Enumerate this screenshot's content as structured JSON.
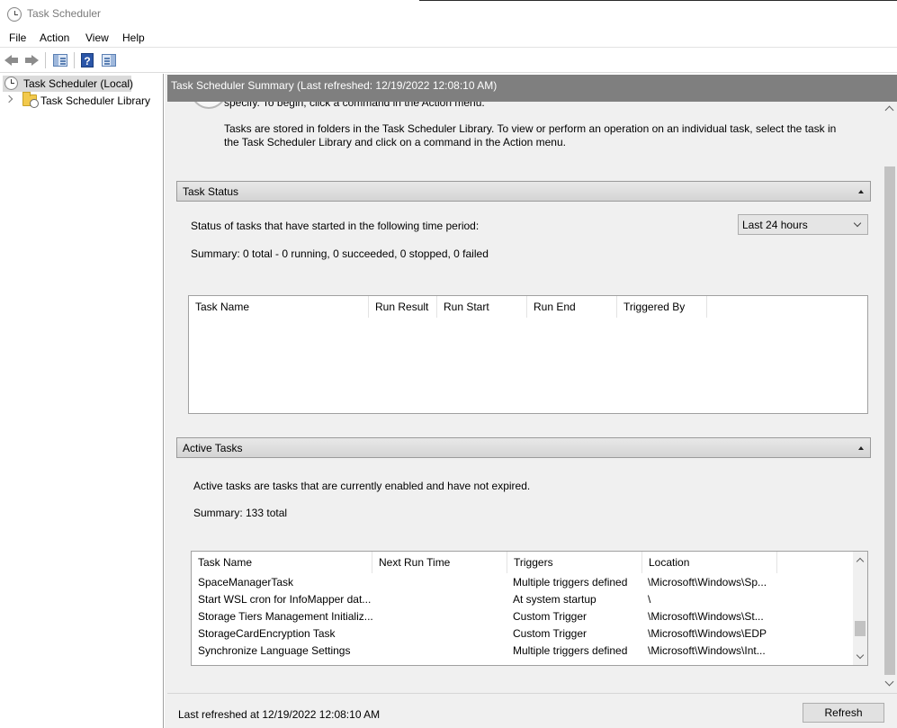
{
  "window": {
    "title": "Task Scheduler"
  },
  "menu": {
    "file": "File",
    "action": "Action",
    "view": "View",
    "help": "Help"
  },
  "toolbar": {
    "help_glyph": "?"
  },
  "tree": {
    "root_label": "Task Scheduler (Local)",
    "library_label": "Task Scheduler Library"
  },
  "content": {
    "header": "Task Scheduler Summary (Last refreshed: 12/19/2022 12:08:10 AM)",
    "intro_partial": "specify. To begin, click a command in the Action menu.",
    "intro_text": "Tasks are stored in folders in the Task Scheduler Library. To view or perform an operation on an individual task, select the task in the Task Scheduler Library and click on a command in the Action menu."
  },
  "task_status": {
    "title": "Task Status",
    "period_label": "Status of tasks that have started in the following time period:",
    "period_value": "Last 24 hours",
    "summary": "Summary: 0 total - 0 running, 0 succeeded, 0 stopped, 0 failed",
    "columns": [
      "Task Name",
      "Run Result",
      "Run Start",
      "Run End",
      "Triggered By"
    ]
  },
  "active_tasks": {
    "title": "Active Tasks",
    "description": "Active tasks are tasks that are currently enabled and have not expired.",
    "summary": "Summary: 133 total",
    "columns": [
      "Task Name",
      "Next Run Time",
      "Triggers",
      "Location"
    ],
    "rows": [
      {
        "name": "SpaceManagerTask",
        "next_run": "",
        "triggers": "Multiple triggers defined",
        "location": "\\Microsoft\\Windows\\Sp..."
      },
      {
        "name": "Start WSL cron for InfoMapper dat...",
        "next_run": "",
        "triggers": "At system startup",
        "location": "\\"
      },
      {
        "name": "Storage Tiers Management Initializ...",
        "next_run": "",
        "triggers": "Custom Trigger",
        "location": "\\Microsoft\\Windows\\St..."
      },
      {
        "name": "StorageCardEncryption Task",
        "next_run": "",
        "triggers": "Custom Trigger",
        "location": "\\Microsoft\\Windows\\EDP"
      },
      {
        "name": "Synchronize Language Settings",
        "next_run": "",
        "triggers": "Multiple triggers defined",
        "location": "\\Microsoft\\Windows\\Int..."
      }
    ]
  },
  "footer": {
    "last_refreshed": "Last refreshed at 12/19/2022 12:08:10 AM",
    "refresh_label": "Refresh"
  }
}
